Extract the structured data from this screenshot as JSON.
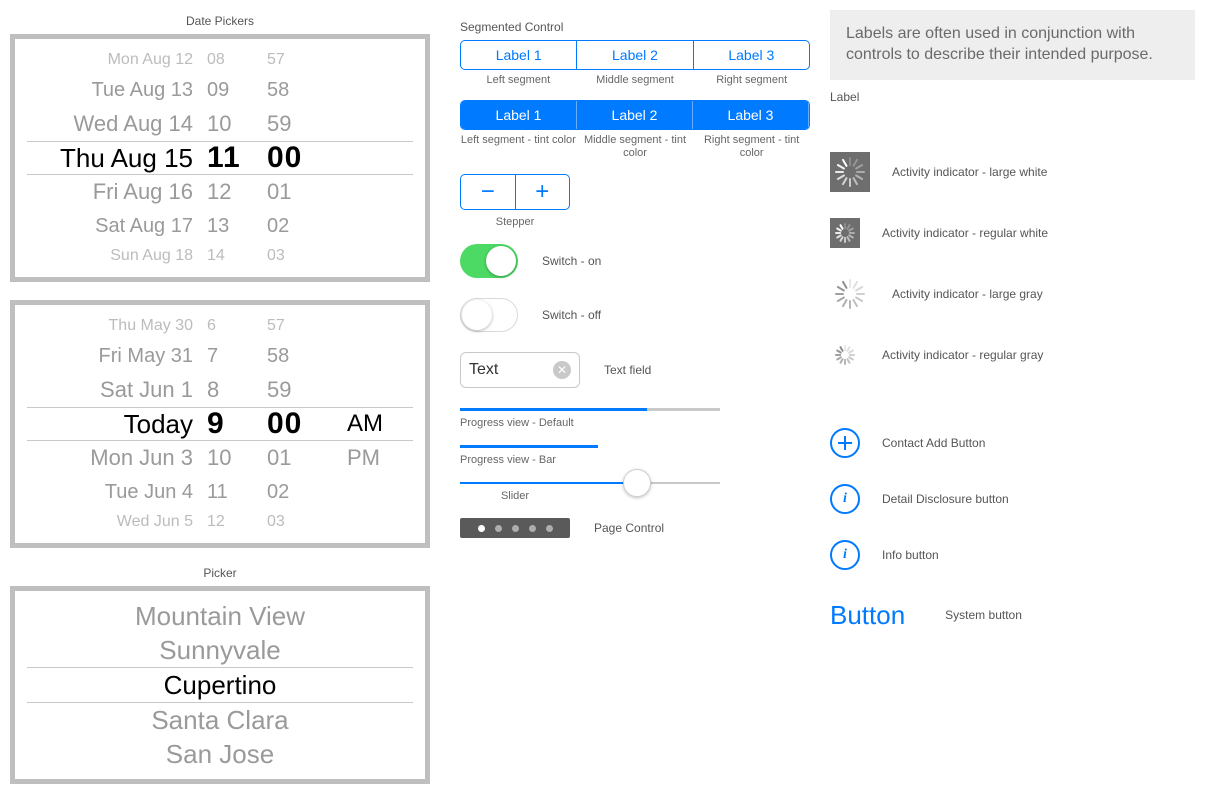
{
  "captions": {
    "date_pickers": "Date Pickers",
    "picker": "Picker",
    "segmented_control": "Segmented Control",
    "left_segment": "Left segment",
    "middle_segment": "Middle segment",
    "right_segment": "Right segment",
    "left_segment_tint": "Left segment - tint color",
    "middle_segment_tint": "Middle segment - tint color",
    "right_segment_tint": "Right segment - tint color",
    "stepper": "Stepper",
    "switch_on": "Switch - on",
    "switch_off": "Switch - off",
    "text_field": "Text field",
    "progress_default": "Progress view - Default",
    "progress_bar": "Progress view - Bar",
    "slider": "Slider",
    "page_control": "Page Control",
    "label_heading": "Label",
    "activity_large_white": "Activity indicator - large white",
    "activity_regular_white": "Activity indicator - regular white",
    "activity_large_gray": "Activity indicator - large gray",
    "activity_regular_gray": "Activity indicator - regular gray",
    "contact_add": "Contact Add Button",
    "detail_disclosure": "Detail Disclosure button",
    "info_button": "Info button",
    "system_button": "System button"
  },
  "label_text": "Labels are often used in conjunction with controls to describe their intended purpose.",
  "system_button_text": "Button",
  "segmented": {
    "labels": [
      "Label 1",
      "Label 2",
      "Label 3"
    ]
  },
  "text_field_value": "Text",
  "date_picker_1": {
    "rows": [
      {
        "date": "Mon Aug 12",
        "hr": "08",
        "min": "57",
        "cls": "fade-far"
      },
      {
        "date": "Tue Aug 13",
        "hr": "09",
        "min": "58",
        "cls": "fade-mid"
      },
      {
        "date": "Wed Aug 14",
        "hr": "10",
        "min": "59",
        "cls": "fade-near"
      },
      {
        "date": "Thu Aug 15",
        "hr": "11",
        "min": "00",
        "cls": "sel"
      },
      {
        "date": "Fri Aug 16",
        "hr": "12",
        "min": "01",
        "cls": "fade-near"
      },
      {
        "date": "Sat Aug 17",
        "hr": "13",
        "min": "02",
        "cls": "fade-mid"
      },
      {
        "date": "Sun Aug 18",
        "hr": "14",
        "min": "03",
        "cls": "fade-far"
      }
    ]
  },
  "date_picker_2": {
    "rows": [
      {
        "date": "Thu May 30",
        "hr": "6",
        "min": "57",
        "ampm": "",
        "cls": "fade-far"
      },
      {
        "date": "Fri May 31",
        "hr": "7",
        "min": "58",
        "ampm": "",
        "cls": "fade-mid"
      },
      {
        "date": "Sat Jun 1",
        "hr": "8",
        "min": "59",
        "ampm": "",
        "cls": "fade-near"
      },
      {
        "date": "Today",
        "hr": "9",
        "min": "00",
        "ampm": "AM",
        "cls": "sel"
      },
      {
        "date": "Mon Jun 3",
        "hr": "10",
        "min": "01",
        "ampm": "PM",
        "cls": "fade-near"
      },
      {
        "date": "Tue Jun 4",
        "hr": "11",
        "min": "02",
        "ampm": "",
        "cls": "fade-mid"
      },
      {
        "date": "Wed Jun 5",
        "hr": "12",
        "min": "03",
        "ampm": "",
        "cls": "fade-far"
      }
    ]
  },
  "single_picker": {
    "options": [
      "Mountain View",
      "Sunnyvale",
      "Cupertino",
      "Santa Clara",
      "San Jose"
    ],
    "selected_index": 2
  },
  "progress": {
    "default_pct": 72,
    "bar_pct": 53
  },
  "slider_pct": 68,
  "page_control": {
    "count": 5,
    "active": 0
  },
  "colors": {
    "accent": "#007aff",
    "switch_on": "#4cd964"
  }
}
